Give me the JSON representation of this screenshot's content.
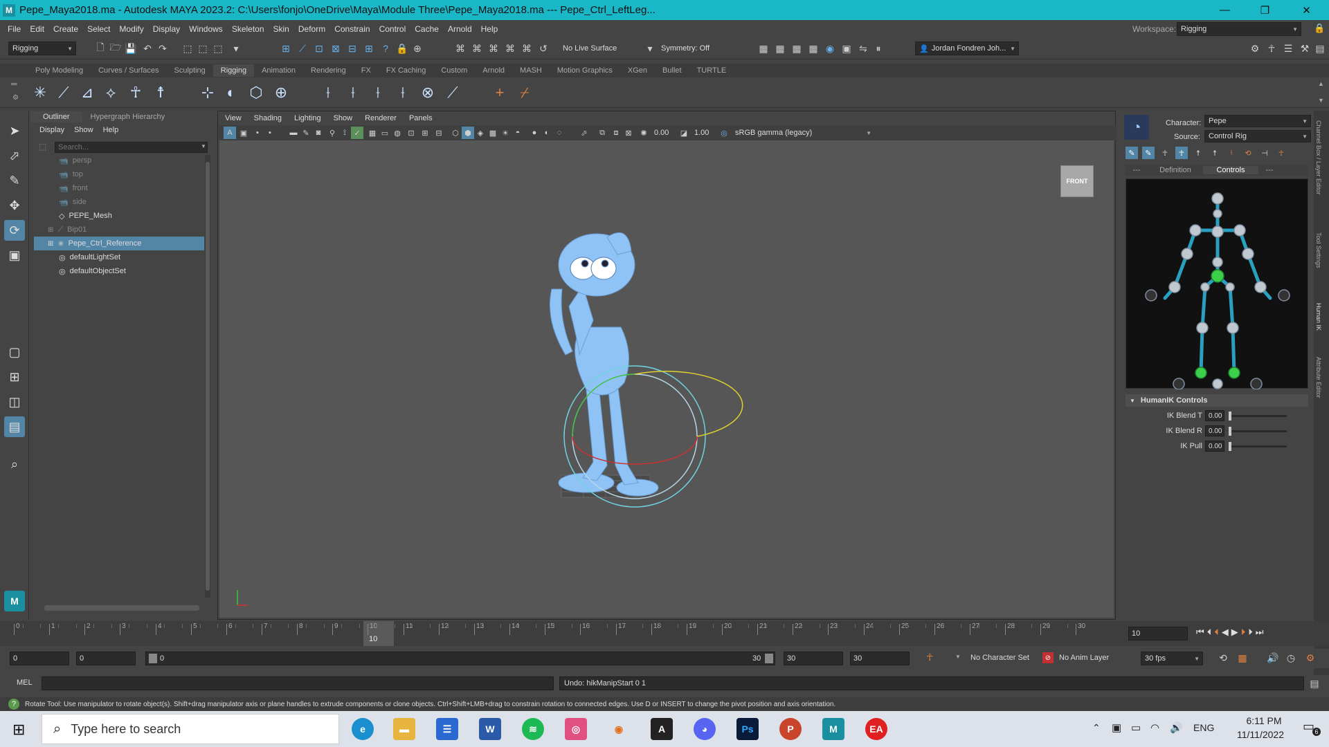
{
  "titlebar": {
    "title": "Pepe_Maya2018.ma - Autodesk MAYA 2023.2: C:\\Users\\fonjo\\OneDrive\\Maya\\Module Three\\Pepe_Maya2018.ma    ---    Pepe_Ctrl_LeftLeg...",
    "minimize": "—",
    "restore": "❐",
    "close": "✕"
  },
  "menubar": {
    "items": [
      "File",
      "Edit",
      "Create",
      "Select",
      "Modify",
      "Display",
      "Windows",
      "Skeleton",
      "Skin",
      "Deform",
      "Constrain",
      "Control",
      "Cache",
      "Arnold",
      "Help"
    ],
    "workspace_label": "Workspace:",
    "workspace_value": "Rigging"
  },
  "statusline": {
    "menuset": "Rigging",
    "live_surface": "No Live Surface",
    "symmetry": "Symmetry: Off",
    "user": "Jordan Fondren Joh..."
  },
  "shelf": {
    "tabs": [
      "Poly Modeling",
      "Curves / Surfaces",
      "Sculpting",
      "Rigging",
      "Animation",
      "Rendering",
      "FX",
      "FX Caching",
      "Custom",
      "Arnold",
      "MASH",
      "Motion Graphics",
      "XGen",
      "Bullet",
      "TURTLE"
    ],
    "active_tab": "Rigging"
  },
  "outliner": {
    "tabs": [
      "Outliner",
      "Hypergraph Hierarchy"
    ],
    "menu": [
      "Display",
      "Show",
      "Help"
    ],
    "search_placeholder": "Search...",
    "items": [
      {
        "label": "persp",
        "type": "camera",
        "dim": true
      },
      {
        "label": "top",
        "type": "camera",
        "dim": true
      },
      {
        "label": "front",
        "type": "camera",
        "dim": true
      },
      {
        "label": "side",
        "type": "camera",
        "dim": true
      },
      {
        "label": "PEPE_Mesh",
        "type": "mesh",
        "dim": false
      },
      {
        "label": "Bip01",
        "type": "joint",
        "dim": true
      },
      {
        "label": "Pepe_Ctrl_Reference",
        "type": "ctrl",
        "dim": false,
        "selected": true
      },
      {
        "label": "defaultLightSet",
        "type": "set",
        "dim": false
      },
      {
        "label": "defaultObjectSet",
        "type": "set",
        "dim": false
      }
    ]
  },
  "viewport": {
    "menu": [
      "View",
      "Shading",
      "Lighting",
      "Show",
      "Renderer",
      "Panels"
    ],
    "exposure": "0.00",
    "gamma": "1.00",
    "colorspace": "sRGB gamma (legacy)",
    "viewcube": "FRONT"
  },
  "humanik": {
    "character_label": "Character:",
    "character": "Pepe",
    "source_label": "Source:",
    "source": "Control Rig",
    "tabs": [
      "---",
      "Definition",
      "Controls",
      "---"
    ],
    "active_tab": "Controls",
    "section": "HumanIK Controls",
    "controls": [
      {
        "label": "IK Blend T",
        "value": "0.00"
      },
      {
        "label": "IK Blend R",
        "value": "0.00"
      },
      {
        "label": "IK Pull",
        "value": "0.00"
      }
    ]
  },
  "side_tabs": [
    "Channel Box / Layer Editor",
    "Tool Settings",
    "Human IK",
    "Attribute Editor"
  ],
  "timeline": {
    "ticks": [
      "0",
      "1",
      "2",
      "3",
      "4",
      "5",
      "6",
      "7",
      "8",
      "9",
      "10",
      "11",
      "12",
      "13",
      "14",
      "15",
      "16",
      "17",
      "18",
      "19",
      "20",
      "21",
      "22",
      "23",
      "24",
      "25",
      "26",
      "27",
      "28",
      "29",
      "30"
    ],
    "current_frame": "10",
    "current_frame_field": "10"
  },
  "range": {
    "start": "0",
    "playback_start": "0",
    "slider_start": "0",
    "slider_end": "30",
    "playback_end": "30",
    "end": "30",
    "character_set": "No Character Set",
    "anim_layer": "No Anim Layer",
    "fps": "30 fps"
  },
  "cmdline": {
    "lang": "MEL",
    "result": "Undo: hikManipStart 0 1"
  },
  "helpline": {
    "text": "Rotate Tool: Use manipulator to rotate object(s). Shift+drag manipulator axis or plane handles to extrude components or clone objects. Ctrl+Shift+LMB+drag to constrain rotation to connected edges. Use D or INSERT to change the pivot position and axis orientation."
  },
  "taskbar": {
    "search_placeholder": "Type here to search",
    "lang": "ENG",
    "time": "6:11 PM",
    "date": "11/11/2022",
    "notifications": "6"
  },
  "colors": {
    "titlebar": "#1ab7c7",
    "selection": "#5285a6",
    "character": "#8fc3f5"
  }
}
